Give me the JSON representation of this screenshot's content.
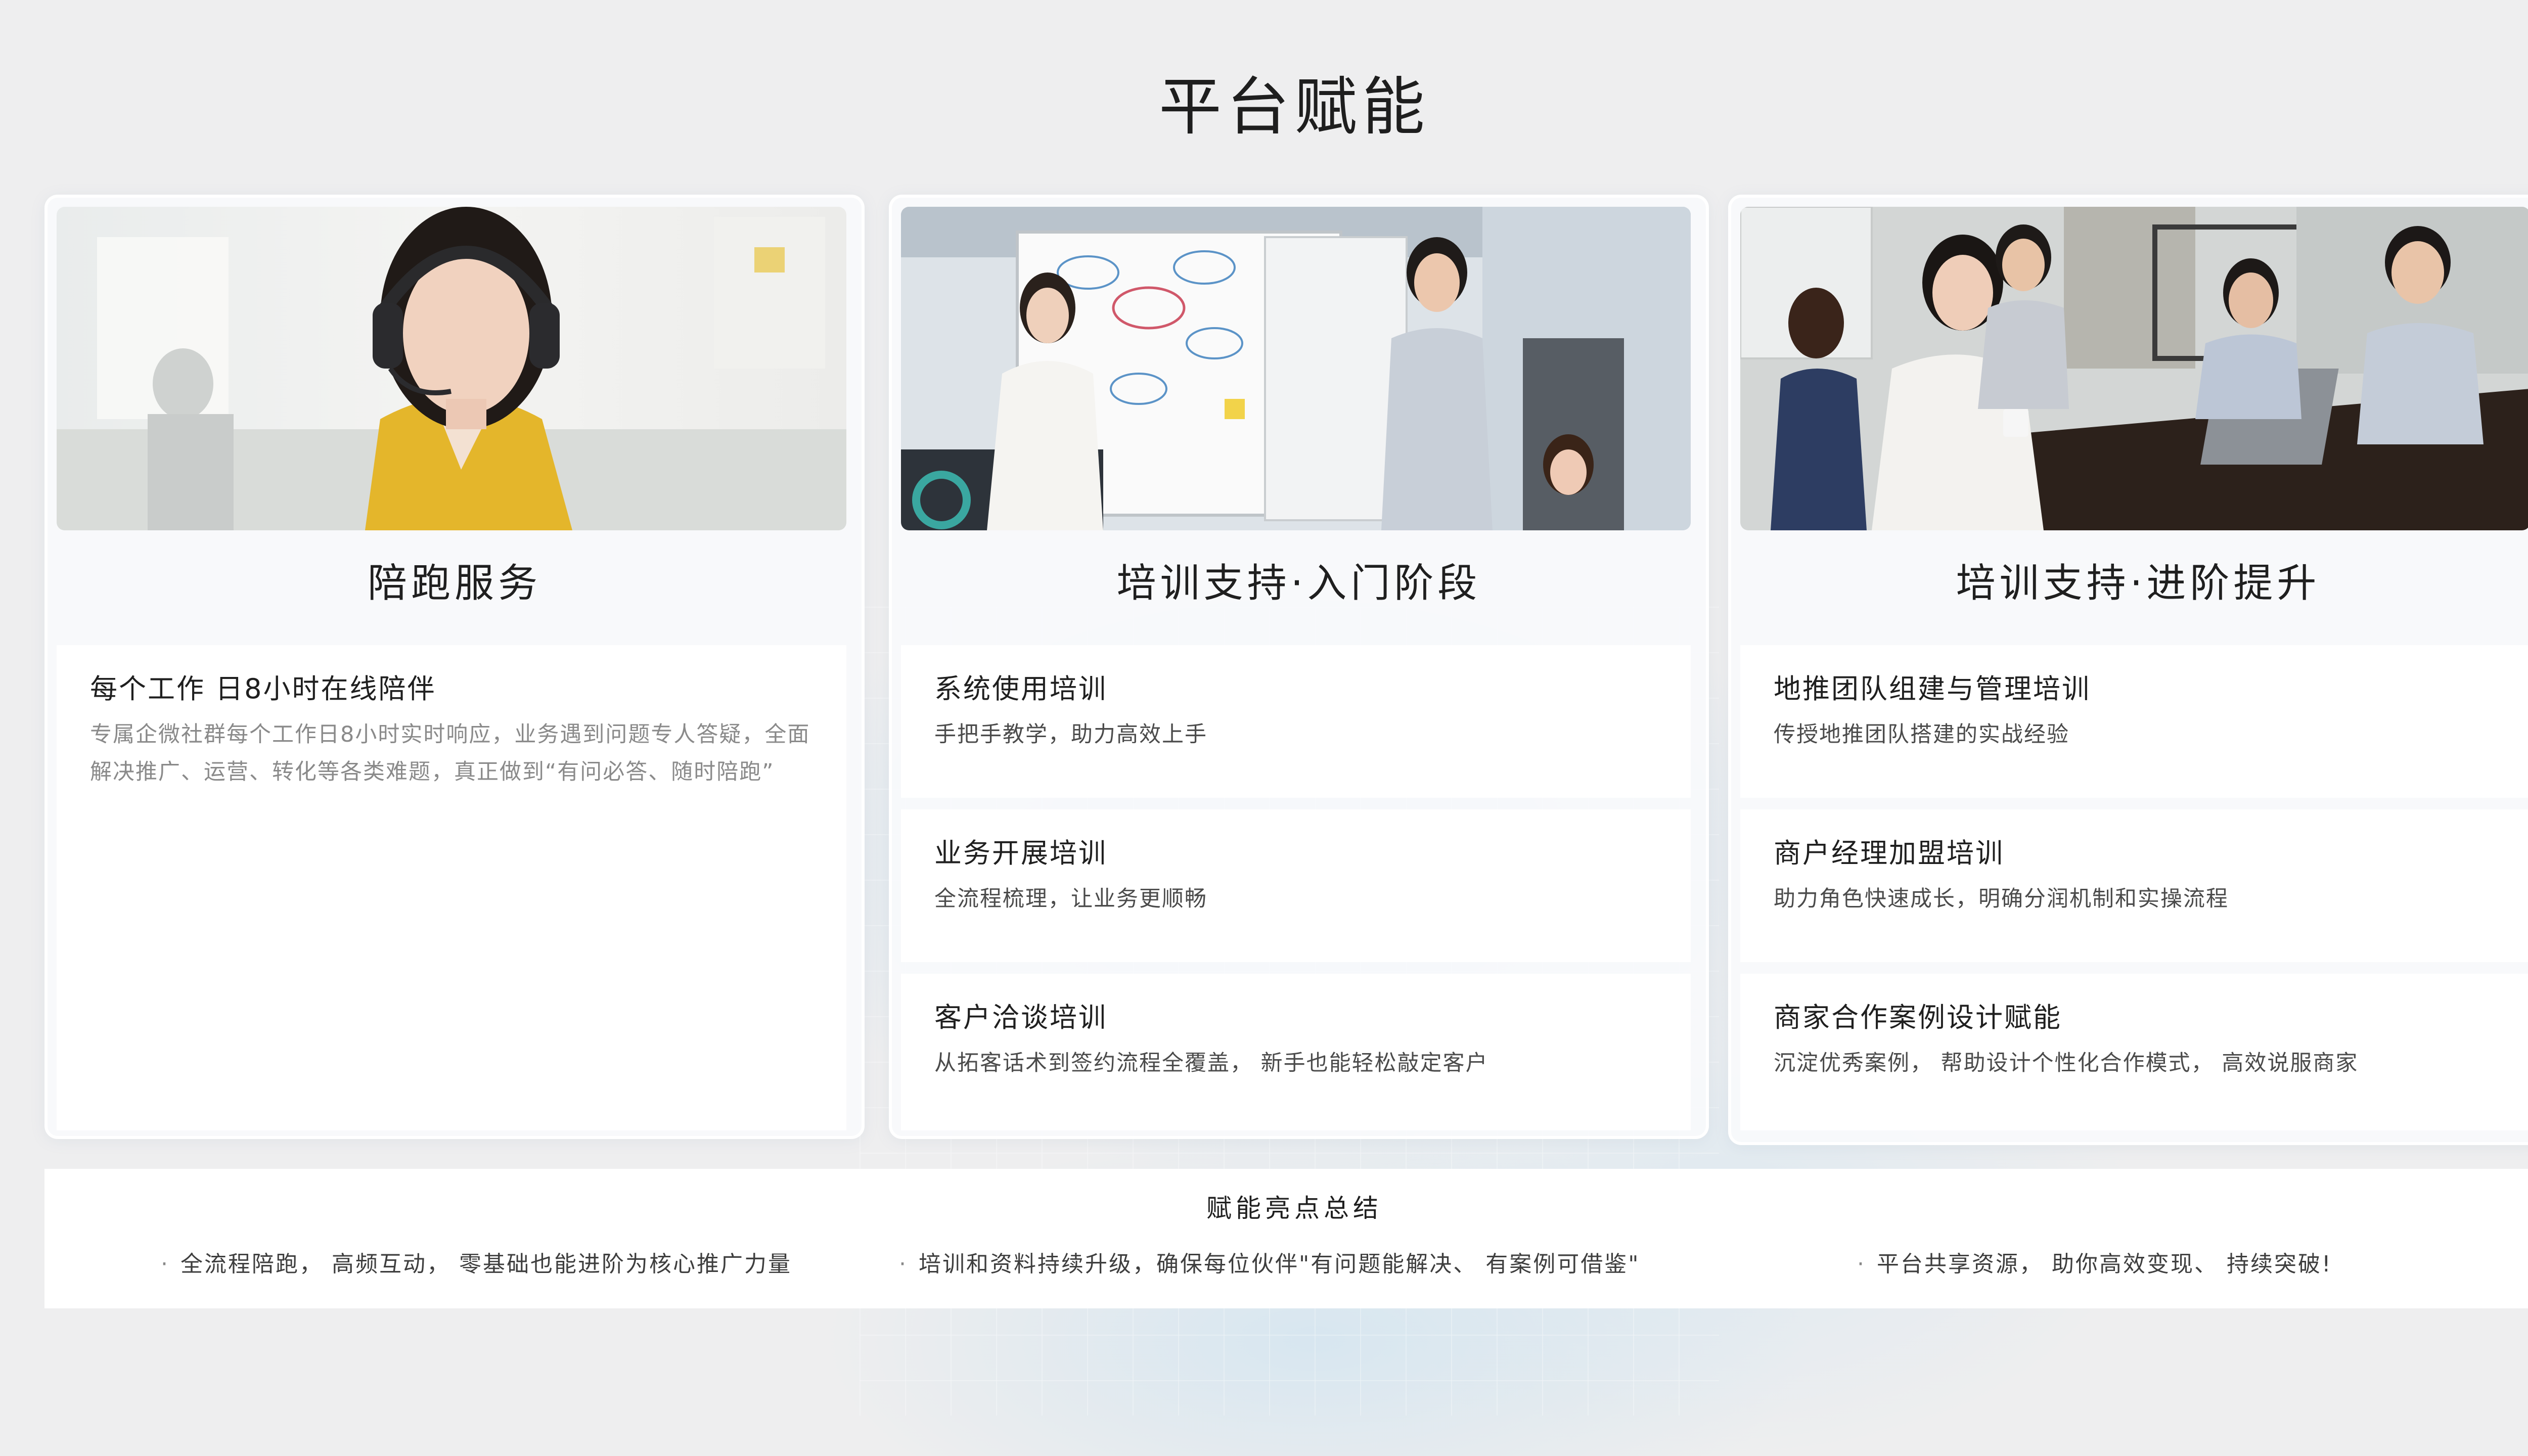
{
  "page": {
    "title": "平台赋能"
  },
  "cards": [
    {
      "title": "陪跑服务",
      "photo": "customer-service-headset-photo",
      "items": [
        {
          "title": "每个工作 日8小时在线陪伴",
          "desc": "专属企微社群每个工作日8小时实时响应，业务遇到问题专人答疑，全面解决推广、运营、转化等各类难题，真正做到“有问必答、随时陪跑”"
        }
      ]
    },
    {
      "title": "培训支持·入门阶段",
      "photo": "whiteboard-training-photo",
      "items": [
        {
          "title": "系统使用培训",
          "desc": "手把手教学，助力高效上手"
        },
        {
          "title": "业务开展培训",
          "desc": "全流程梳理，让业务更顺畅"
        },
        {
          "title": "客户洽谈培训",
          "desc": "从拓客话术到签约流程全覆盖， 新手也能轻松敲定客户"
        }
      ]
    },
    {
      "title": "培训支持·进阶提升",
      "photo": "team-meeting-photo",
      "items": [
        {
          "title": "地推团队组建与管理培训",
          "desc": "传授地推团队搭建的实战经验"
        },
        {
          "title": "商户经理加盟培训",
          "desc": "助力角色快速成长，明确分润机制和实操流程"
        },
        {
          "title": "商家合作案例设计赋能",
          "desc": "沉淀优秀案例， 帮助设计个性化合作模式， 高效说服商家"
        }
      ]
    }
  ],
  "summary": {
    "title": "赋能亮点总结",
    "points": [
      "全流程陪跑， 高频互动， 零基础也能进阶为核心推广力量",
      "培训和资料持续升级，确保每位伙伴\"有问题能解决、  有案例可借鉴\"",
      "平台共享资源， 助你高效变现、  持续突破!"
    ]
  }
}
